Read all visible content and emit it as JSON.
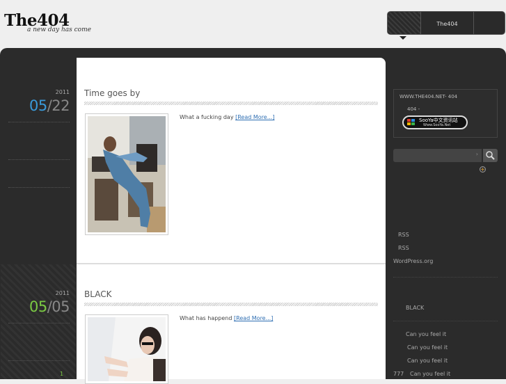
{
  "header": {
    "logo_title": "The404",
    "tagline": "a new day has come",
    "nav_item": "The404"
  },
  "posts": [
    {
      "year": "2011",
      "month": "05",
      "day": "22",
      "month_color": "#3a9ad9",
      "title": "Time goes by",
      "excerpt": "What a fucking day",
      "more_link": "[Read More...]"
    },
    {
      "year": "2011",
      "month": "05",
      "day": "05",
      "month_color": "#7ac943",
      "title": "BLACK",
      "excerpt": "What has happend",
      "more_link": "[Read More...]"
    }
  ],
  "sidebar": {
    "box_line1": "WWW.THE404.NET- 404",
    "box_line2": "404  -",
    "badge_text": "SooYa中文资讯站",
    "badge_url": "Www.SooYa.Net",
    "search_caret": "›",
    "meta_links": [
      "RSS",
      "RSS",
      "WordPress.org"
    ],
    "category": "BLACK",
    "recent": [
      {
        "prefix": "",
        "label": "Can you feel it"
      },
      {
        "prefix": "",
        "label": "Can you feel it"
      },
      {
        "prefix": "",
        "label": "Can you feel it"
      },
      {
        "prefix": "777",
        "label": "Can you feel it"
      }
    ]
  },
  "pagination": {
    "current": "1"
  },
  "colors": {
    "accent_blue": "#3a9ad9",
    "accent_green": "#7ac943",
    "link": "#2f6fb3"
  }
}
